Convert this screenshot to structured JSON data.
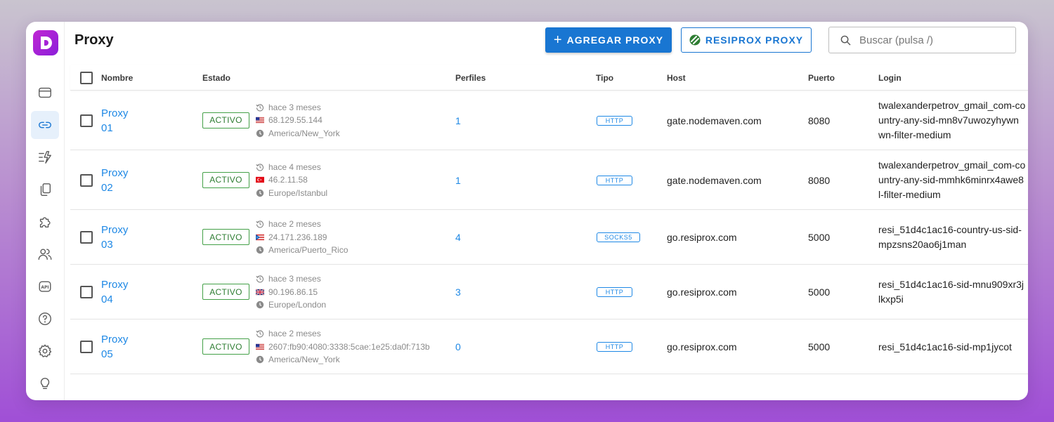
{
  "header": {
    "title": "Proxy",
    "add_button": "AGREGAR PROXY",
    "resiprox_button": "RESIPROX PROXY",
    "search_placeholder": "Buscar (pulsa /)"
  },
  "sidebar": {
    "items": [
      {
        "icon": "browser-window-icon",
        "active": false
      },
      {
        "icon": "link-icon",
        "active": true
      },
      {
        "icon": "automation-icon",
        "active": false
      },
      {
        "icon": "copy-pages-icon",
        "active": false
      },
      {
        "icon": "puzzle-extension-icon",
        "active": false
      },
      {
        "icon": "users-icon",
        "active": false
      },
      {
        "icon": "api-icon",
        "active": false
      },
      {
        "icon": "help-icon",
        "active": false
      },
      {
        "icon": "settings-gear-icon",
        "active": false
      },
      {
        "icon": "lightbulb-icon",
        "active": false
      }
    ]
  },
  "table": {
    "columns": {
      "nombre": "Nombre",
      "estado": "Estado",
      "perfiles": "Perfiles",
      "tipo": "Tipo",
      "host": "Host",
      "puerto": "Puerto",
      "login": "Login"
    },
    "rows": [
      {
        "name_line1": "Proxy",
        "name_line2": "01",
        "status": "ACTIVO",
        "checked_ago": "hace 3 meses",
        "flag": "us",
        "ip": "68.129.55.144",
        "timezone": "America/New_York",
        "profiles": "1",
        "type": "HTTP",
        "host": "gate.nodemaven.com",
        "port": "8080",
        "login": "twalexanderpetrov_gmail_com-country-any-sid-mn8v7uwozyhywnwn-filter-medium"
      },
      {
        "name_line1": "Proxy",
        "name_line2": "02",
        "status": "ACTIVO",
        "checked_ago": "hace 4 meses",
        "flag": "tr",
        "ip": "46.2.11.58",
        "timezone": "Europe/Istanbul",
        "profiles": "1",
        "type": "HTTP",
        "host": "gate.nodemaven.com",
        "port": "8080",
        "login": "twalexanderpetrov_gmail_com-country-any-sid-mmhk6minrx4awe8l-filter-medium"
      },
      {
        "name_line1": "Proxy",
        "name_line2": "03",
        "status": "ACTIVO",
        "checked_ago": "hace 2 meses",
        "flag": "pr",
        "ip": "24.171.236.189",
        "timezone": "America/Puerto_Rico",
        "profiles": "4",
        "type": "SOCKS5",
        "host": "go.resiprox.com",
        "port": "5000",
        "login": "resi_51d4c1ac16-country-us-sid-mpzsns20ao6j1man"
      },
      {
        "name_line1": "Proxy",
        "name_line2": "04",
        "status": "ACTIVO",
        "checked_ago": "hace 3 meses",
        "flag": "gb",
        "ip": "90.196.86.15",
        "timezone": "Europe/London",
        "profiles": "3",
        "type": "HTTP",
        "host": "go.resiprox.com",
        "port": "5000",
        "login": "resi_51d4c1ac16-sid-mnu909xr3jlkxp5i"
      },
      {
        "name_line1": "Proxy",
        "name_line2": "05",
        "status": "ACTIVO",
        "checked_ago": "hace 2 meses",
        "flag": "us",
        "ip": "2607:fb90:4080:3338:5cae:1e25:da0f:713b",
        "timezone": "America/New_York",
        "profiles": "0",
        "type": "HTTP",
        "host": "go.resiprox.com",
        "port": "5000",
        "login": "resi_51d4c1ac16-sid-mp1jycot"
      }
    ]
  },
  "colors": {
    "primary": "#1976d2",
    "link": "#1e88e5",
    "active_green": "#43a047",
    "brand_purple": "#a826d9"
  }
}
